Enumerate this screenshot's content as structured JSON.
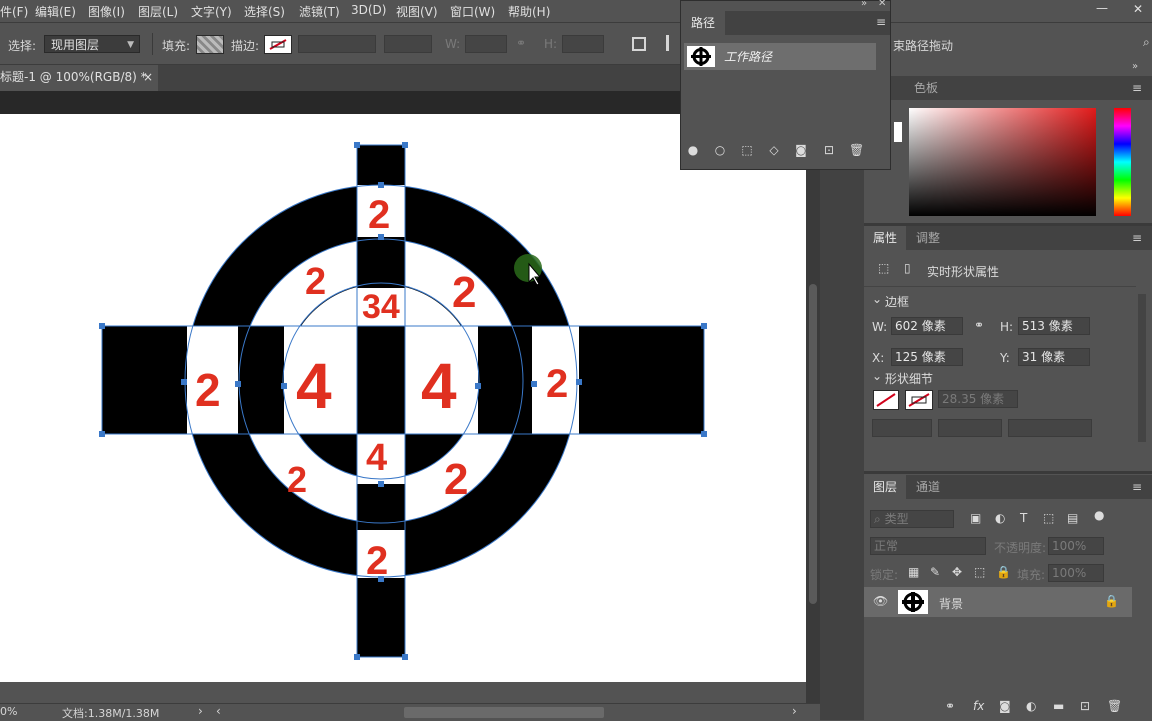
{
  "menubar": {
    "items": [
      "件(F)",
      "编辑(E)",
      "图像(I)",
      "图层(L)",
      "文字(Y)",
      "选择(S)",
      "滤镜(T)",
      "3D(D)",
      "视图(V)",
      "窗口(W)",
      "帮助(H)"
    ],
    "minimize": "—",
    "close": "✕"
  },
  "options": {
    "select_label": "选择:",
    "select_value": "现用图层",
    "fill_label": "填充:",
    "stroke_label": "描边:",
    "w_label": "W:",
    "h_label": "H:",
    "constrain_path": "束路径拖动"
  },
  "document": {
    "tab_title": "标题-1 @ 100%(RGB/8) *",
    "tab_close": "×",
    "zoom": "0%",
    "doc_info": "文档:1.38M/1.38M",
    "numbers": {
      "two": "2",
      "four": "4",
      "mixed": "34"
    }
  },
  "paths_panel": {
    "tab": "路径",
    "path_name": "工作路径"
  },
  "color_panel": {
    "tab_partial": "色",
    "tab": "色板"
  },
  "properties_panel": {
    "tab": "属性",
    "tab2": "调整",
    "title": "实时形状属性",
    "section_bounds": "边框",
    "w_label": "W:",
    "w_value": "602 像素",
    "h_label": "H:",
    "h_value": "513 像素",
    "x_label": "X:",
    "x_value": "125 像素",
    "y_label": "Y:",
    "y_value": "31 像素",
    "section_shape": "形状细节",
    "stroke_width": "28.35 像素"
  },
  "layers_panel": {
    "tab": "图层",
    "tab2": "通道",
    "filter": "类型",
    "blend_mode": "正常",
    "opacity_label": "不透明度:",
    "opacity_value": "100%",
    "lock_label": "锁定:",
    "fill_label": "填充:",
    "fill_value": "100%",
    "layer_name": "背景"
  }
}
